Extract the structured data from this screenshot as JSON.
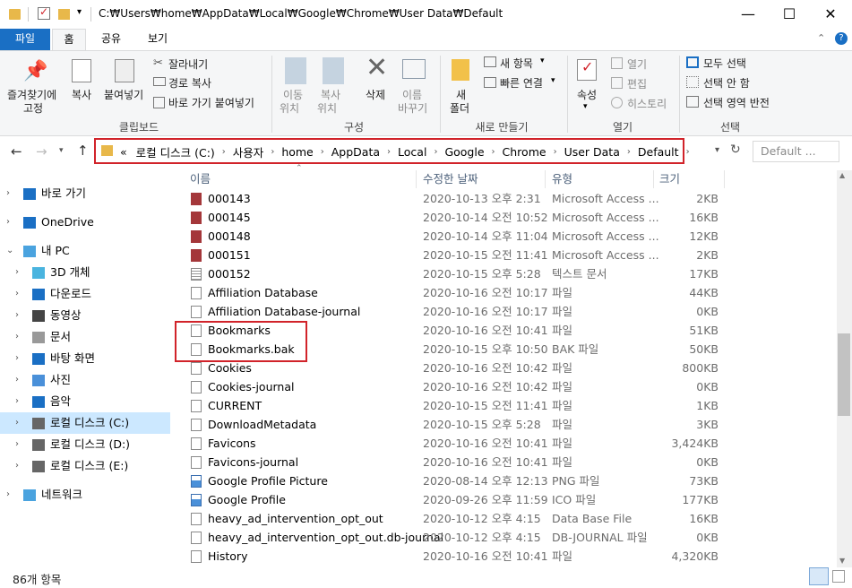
{
  "window": {
    "title_path": "C:₩Users₩home₩AppData₩Local₩Google₩Chrome₩User Data₩Default",
    "min_icon": "minimize-icon",
    "max_icon": "maximize-icon",
    "close_icon": "close-icon"
  },
  "tabs": [
    {
      "label": "파일"
    },
    {
      "label": "홈"
    },
    {
      "label": "공유"
    },
    {
      "label": "보기"
    }
  ],
  "ribbon": {
    "clipboard": {
      "pin_line1": "즐겨찾기에",
      "pin_line2": "고정",
      "copy": "복사",
      "paste": "붙여넣기",
      "cut": "잘라내기",
      "copy_path": "경로 복사",
      "paste_shortcut": "바로 가기 붙여넣기",
      "title": "클립보드"
    },
    "organize": {
      "move_l1": "이동",
      "move_l2": "위치",
      "copy_l1": "복사",
      "copy_l2": "위치",
      "delete": "삭제",
      "rename_l1": "이름",
      "rename_l2": "바꾸기",
      "title": "구성"
    },
    "new": {
      "folder_l1": "새",
      "folder_l2": "폴더",
      "new_item": "새 항목",
      "easy_access": "빠른 연결",
      "title": "새로 만들기"
    },
    "open": {
      "properties": "속성",
      "open": "열기",
      "edit": "편집",
      "history": "히스토리",
      "title": "열기"
    },
    "select": {
      "select_all": "모두 선택",
      "select_none": "선택 안 함",
      "invert": "선택 영역 반전",
      "title": "선택"
    }
  },
  "address": {
    "crumbs": [
      "«",
      "로컬 디스크 (C:)",
      "사용자",
      "home",
      "AppData",
      "Local",
      "Google",
      "Chrome",
      "User Data",
      "Default"
    ],
    "search_placeholder": "Default ..."
  },
  "nav": [
    {
      "label": "바로 가기",
      "icon": "star-icon"
    },
    {
      "label": "OneDrive",
      "icon": "cloud-icon"
    },
    {
      "label": "내 PC",
      "icon": "computer-icon"
    },
    {
      "label": "3D 개체",
      "icon": "cube-icon"
    },
    {
      "label": "다운로드",
      "icon": "download-icon"
    },
    {
      "label": "동영상",
      "icon": "video-icon"
    },
    {
      "label": "문서",
      "icon": "document-icon"
    },
    {
      "label": "바탕 화면",
      "icon": "desktop-icon"
    },
    {
      "label": "사진",
      "icon": "picture-icon"
    },
    {
      "label": "음악",
      "icon": "music-icon"
    },
    {
      "label": "로컬 디스크 (C:)",
      "icon": "drive-icon"
    },
    {
      "label": "로컬 디스크 (D:)",
      "icon": "drive-icon"
    },
    {
      "label": "로컬 디스크 (E:)",
      "icon": "drive-icon"
    },
    {
      "label": "네트워크",
      "icon": "network-icon"
    }
  ],
  "columns": {
    "name": "이름",
    "date": "수정한 날짜",
    "type": "유형",
    "size": "크기"
  },
  "files": [
    {
      "name": "000143",
      "date": "2020-10-13 오후 2:31",
      "type": "Microsoft Access ...",
      "size": "2KB",
      "icon": "access-file-icon"
    },
    {
      "name": "000145",
      "date": "2020-10-14 오전 10:52",
      "type": "Microsoft Access ...",
      "size": "16KB",
      "icon": "access-file-icon"
    },
    {
      "name": "000148",
      "date": "2020-10-14 오후 11:04",
      "type": "Microsoft Access ...",
      "size": "12KB",
      "icon": "access-file-icon"
    },
    {
      "name": "000151",
      "date": "2020-10-15 오전 11:41",
      "type": "Microsoft Access ...",
      "size": "2KB",
      "icon": "access-file-icon"
    },
    {
      "name": "000152",
      "date": "2020-10-15 오후 5:28",
      "type": "텍스트 문서",
      "size": "17KB",
      "icon": "text-file-icon"
    },
    {
      "name": "Affiliation Database",
      "date": "2020-10-16 오전 10:17",
      "type": "파일",
      "size": "44KB",
      "icon": "file-icon"
    },
    {
      "name": "Affiliation Database-journal",
      "date": "2020-10-16 오전 10:17",
      "type": "파일",
      "size": "0KB",
      "icon": "file-icon"
    },
    {
      "name": "Bookmarks",
      "date": "2020-10-16 오전 10:41",
      "type": "파일",
      "size": "51KB",
      "icon": "file-icon"
    },
    {
      "name": "Bookmarks.bak",
      "date": "2020-10-15 오후 10:50",
      "type": "BAK 파일",
      "size": "50KB",
      "icon": "file-icon"
    },
    {
      "name": "Cookies",
      "date": "2020-10-16 오전 10:42",
      "type": "파일",
      "size": "800KB",
      "icon": "file-icon"
    },
    {
      "name": "Cookies-journal",
      "date": "2020-10-16 오전 10:42",
      "type": "파일",
      "size": "0KB",
      "icon": "file-icon"
    },
    {
      "name": "CURRENT",
      "date": "2020-10-15 오전 11:41",
      "type": "파일",
      "size": "1KB",
      "icon": "file-icon"
    },
    {
      "name": "DownloadMetadata",
      "date": "2020-10-15 오후 5:28",
      "type": "파일",
      "size": "3KB",
      "icon": "file-icon"
    },
    {
      "name": "Favicons",
      "date": "2020-10-16 오전 10:41",
      "type": "파일",
      "size": "3,424KB",
      "icon": "file-icon"
    },
    {
      "name": "Favicons-journal",
      "date": "2020-10-16 오전 10:41",
      "type": "파일",
      "size": "0KB",
      "icon": "file-icon"
    },
    {
      "name": "Google Profile Picture",
      "date": "2020-08-14 오후 12:13",
      "type": "PNG 파일",
      "size": "73KB",
      "icon": "image-file-icon"
    },
    {
      "name": "Google Profile",
      "date": "2020-09-26 오후 11:59",
      "type": "ICO 파일",
      "size": "177KB",
      "icon": "image-file-icon"
    },
    {
      "name": "heavy_ad_intervention_opt_out",
      "date": "2020-10-12 오후 4:15",
      "type": "Data Base File",
      "size": "16KB",
      "icon": "db-file-icon"
    },
    {
      "name": "heavy_ad_intervention_opt_out.db-journal",
      "date": "2020-10-12 오후 4:15",
      "type": "DB-JOURNAL 파일",
      "size": "0KB",
      "icon": "file-icon"
    },
    {
      "name": "History",
      "date": "2020-10-16 오전 10:41",
      "type": "파일",
      "size": "4,320KB",
      "icon": "file-icon"
    }
  ],
  "status": {
    "count": "86개 항목"
  }
}
